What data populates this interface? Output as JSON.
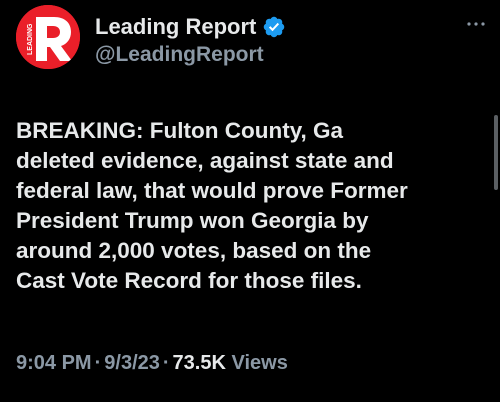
{
  "author": {
    "display_name": "Leading Report",
    "handle": "@LeadingReport",
    "avatar_text": "LEADING",
    "avatar_letter": "R",
    "verified": true,
    "verified_color": "#1d9bf0",
    "avatar_color": "#ea1f29"
  },
  "tweet": {
    "text": "BREAKING: Fulton County, Ga\ndeleted evidence, against state and\nfederal law, that would prove Former\nPresident Trump won Georgia by\naround 2,000 votes, based on the\nCast Vote Record for those files."
  },
  "meta": {
    "time": "9:04 PM",
    "separator": "·",
    "date": "9/3/23",
    "views_count": "73.5K",
    "views_label": "Views"
  },
  "icons": {
    "more": "more-horizontal-icon",
    "verified": "verified-badge-icon"
  }
}
